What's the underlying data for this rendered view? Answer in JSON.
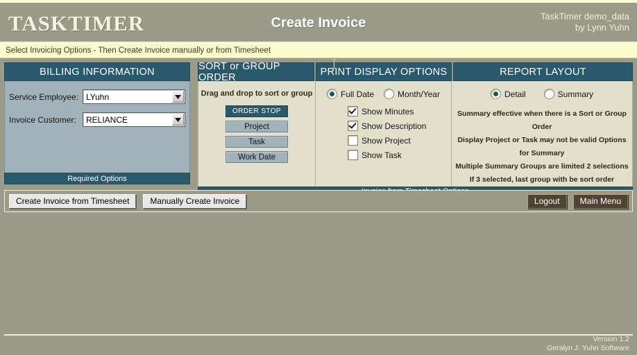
{
  "header": {
    "brand": "TASKTIMER",
    "title": "Create Invoice",
    "account_line1": "TaskTimer demo_data",
    "account_line2": "by Lynn Yuhn"
  },
  "instruction": "Select Invoicing Options - Then Create Invoice manually or from Timesheet",
  "billing": {
    "title": "BILLING INFORMATION",
    "footer": "Required Options",
    "fields": [
      {
        "label": "Service Employee:",
        "value": "LYuhn"
      },
      {
        "label": "Invoice Customer:",
        "value": "RELIANCE"
      }
    ]
  },
  "sort_group": {
    "title": "SORT or GROUP ORDER",
    "hint": "Drag and drop to sort or group",
    "items": [
      {
        "label": "ORDER STOP",
        "type": "stop"
      },
      {
        "label": "Project",
        "type": "item"
      },
      {
        "label": "Task",
        "type": "item"
      },
      {
        "label": "Work Date",
        "type": "item"
      }
    ]
  },
  "print_display": {
    "title": "PRINT DISPLAY OPTIONS",
    "date_mode": [
      {
        "label": "Full Date",
        "selected": true
      },
      {
        "label": "Month/Year",
        "selected": false
      }
    ],
    "checkboxes": [
      {
        "label": "Show Minutes",
        "checked": true
      },
      {
        "label": "Show Description",
        "checked": true
      },
      {
        "label": "Show Project",
        "checked": false
      },
      {
        "label": "Show Task",
        "checked": false
      }
    ]
  },
  "report_layout": {
    "title": "REPORT LAYOUT",
    "options": [
      {
        "label": "Detail",
        "selected": true
      },
      {
        "label": "Summary",
        "selected": false
      }
    ],
    "notes": [
      "Summary effective when there is a Sort or Group Order",
      "Display Project or Task may not be valid Options for Summary",
      "Multiple Summary Groups are limited 2 selections",
      "If 3 selected, last group with be sort order"
    ]
  },
  "shared_footer": "Invoice from Timesheet Options",
  "actions": {
    "create_from_timesheet": "Create Invoice from Timesheet",
    "manually_create": "Manually Create Invoice",
    "logout": "Logout",
    "main_menu": "Main Menu"
  },
  "footer": {
    "version": "Version 1.2",
    "company": "Geralyn J. Yuhn Software"
  },
  "colors": {
    "page_background": "#9a9b88",
    "panel_header": "#2b596c",
    "panel_body_beige": "#e2dfca",
    "panel_body_blue": "#a2b2ba",
    "instruction_bar": "#fbfbd0",
    "radio_dot": "#1b5b4e",
    "dark_button": "#4f4334"
  }
}
